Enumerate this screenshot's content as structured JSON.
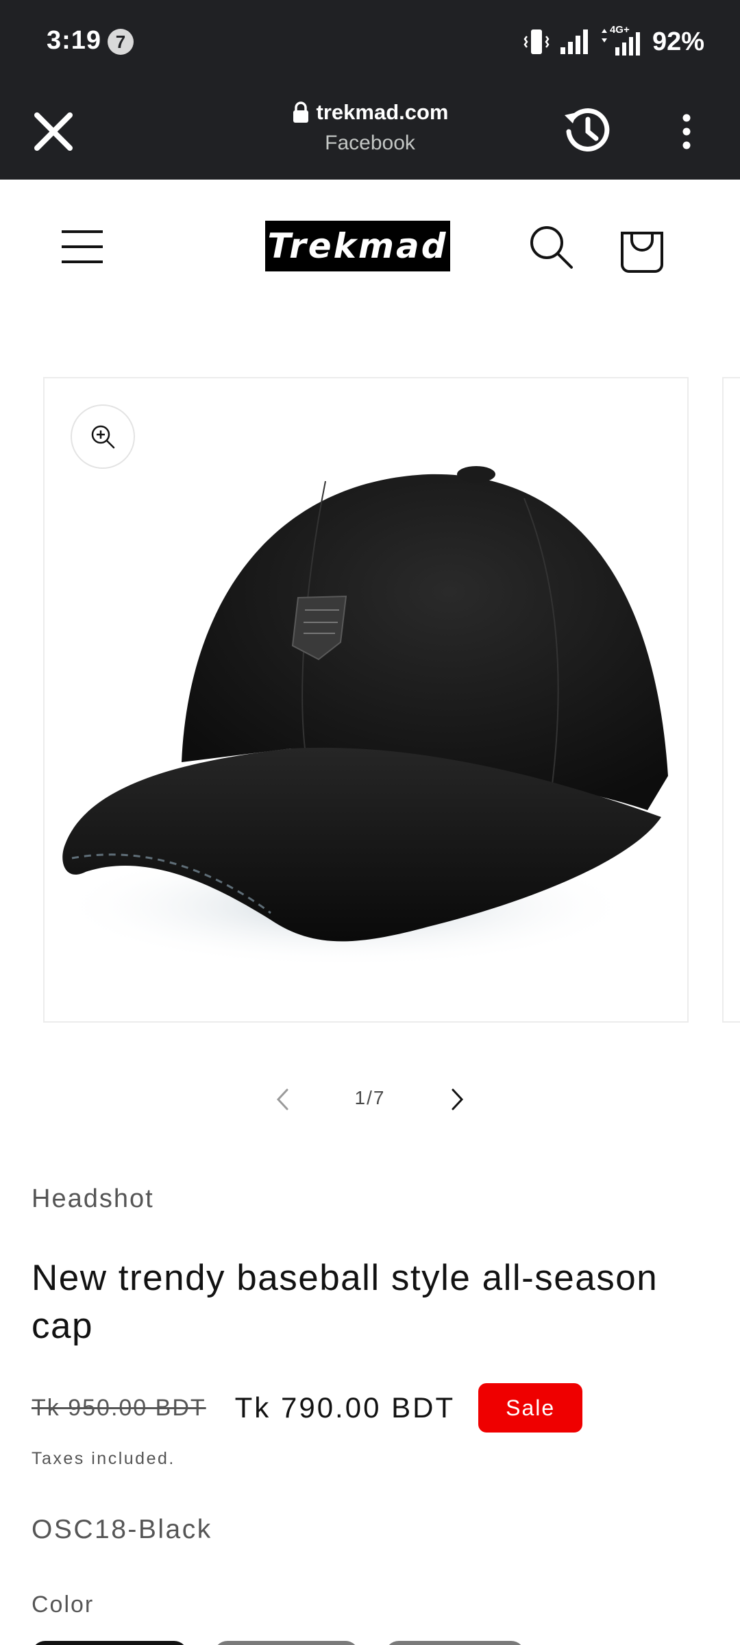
{
  "status_bar": {
    "time": "3:19",
    "notification_count": "7",
    "network": "4G+",
    "battery": "92%"
  },
  "browser": {
    "domain": "trekmad.com",
    "source": "Facebook"
  },
  "header": {
    "logo_text": "Trekmad"
  },
  "gallery": {
    "counter": "1/7"
  },
  "product": {
    "vendor": "Headshot",
    "title": "New trendy baseball style all-season cap",
    "price_regular": "Tk 950.00 BDT",
    "price_sale": "Tk 790.00 BDT",
    "sale_badge": "Sale",
    "taxes_note": "Taxes included.",
    "sku": "OSC18-Black",
    "color_label": "Color"
  },
  "colors": {
    "browser_bg": "#202124",
    "sale_badge": "#ef0000",
    "text": "#121212"
  }
}
